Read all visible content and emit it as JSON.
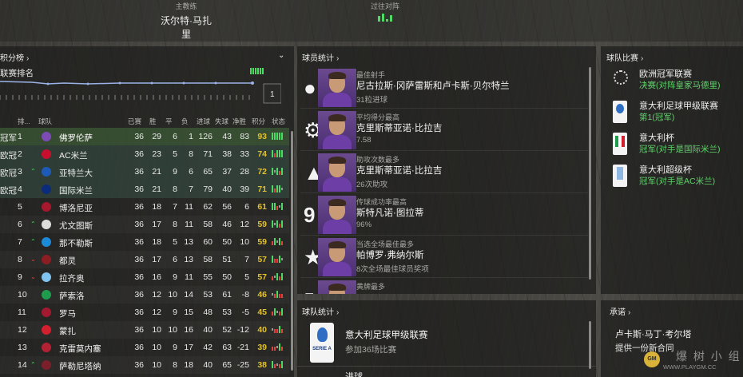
{
  "header": {
    "manager_label": "主教练",
    "manager_name": "沃尔特·马扎里",
    "h2h_label": "过往对阵",
    "h2h_bars": [
      0.7,
      1.0,
      0.35,
      0.8
    ]
  },
  "standings": {
    "title": "积分榜",
    "subtitle": "联赛排名",
    "graph_current": "1",
    "columns": [
      "排...",
      "球队",
      "已赛",
      "胜",
      "平",
      "负",
      "进球",
      "失球",
      "净胜",
      "积分",
      "状态"
    ],
    "rows": [
      {
        "qual": "冠军",
        "pos": "1",
        "move": "",
        "team": "佛罗伦萨",
        "logo": "#7c4bb3",
        "p": "36",
        "w": "29",
        "d": "6",
        "l": "1",
        "gf": "126",
        "ga": "43",
        "gd": "83",
        "pts": "93",
        "form": [
          "W",
          "W",
          "W",
          "W",
          "W"
        ],
        "highlight": true
      },
      {
        "qual": "欧冠",
        "pos": "2",
        "move": "",
        "team": "AC米兰",
        "logo": "#c8102e",
        "p": "36",
        "w": "23",
        "d": "5",
        "l": "8",
        "gf": "71",
        "ga": "38",
        "gd": "33",
        "pts": "74",
        "form": [
          "W",
          "L",
          "W",
          "W",
          "W"
        ]
      },
      {
        "qual": "欧冠",
        "pos": "3",
        "move": "up",
        "team": "亚特兰大",
        "logo": "#1e5bb8",
        "p": "36",
        "w": "21",
        "d": "9",
        "l": "6",
        "gf": "65",
        "ga": "37",
        "gd": "28",
        "pts": "72",
        "form": [
          "W",
          "D",
          "W",
          "L",
          "W"
        ]
      },
      {
        "qual": "欧冠",
        "pos": "4",
        "move": "",
        "team": "国际米兰",
        "logo": "#0a2c7a",
        "p": "36",
        "w": "21",
        "d": "8",
        "l": "7",
        "gf": "79",
        "ga": "40",
        "gd": "39",
        "pts": "71",
        "form": [
          "W",
          "L",
          "W",
          "W",
          "D"
        ]
      },
      {
        "qual": "",
        "pos": "5",
        "move": "",
        "team": "博洛尼亚",
        "logo": "#a5182d",
        "p": "36",
        "w": "18",
        "d": "7",
        "l": "11",
        "gf": "62",
        "ga": "56",
        "gd": "6",
        "pts": "61",
        "form": [
          "W",
          "W",
          "L",
          "D",
          "W"
        ]
      },
      {
        "qual": "",
        "pos": "6",
        "move": "up",
        "team": "尤文图斯",
        "logo": "#dddddd",
        "p": "36",
        "w": "17",
        "d": "8",
        "l": "11",
        "gf": "58",
        "ga": "46",
        "gd": "12",
        "pts": "59",
        "form": [
          "W",
          "D",
          "W",
          "L",
          "W"
        ]
      },
      {
        "qual": "",
        "pos": "7",
        "move": "up",
        "team": "那不勒斯",
        "logo": "#1c8ad6",
        "p": "36",
        "w": "18",
        "d": "5",
        "l": "13",
        "gf": "60",
        "ga": "50",
        "gd": "10",
        "pts": "59",
        "form": [
          "L",
          "W",
          "D",
          "W",
          "L"
        ]
      },
      {
        "qual": "",
        "pos": "8",
        "move": "down",
        "team": "都灵",
        "logo": "#8b1e22",
        "p": "36",
        "w": "17",
        "d": "6",
        "l": "13",
        "gf": "58",
        "ga": "51",
        "gd": "7",
        "pts": "57",
        "form": [
          "W",
          "L",
          "L",
          "W",
          "D"
        ]
      },
      {
        "qual": "",
        "pos": "9",
        "move": "down",
        "team": "拉齐奥",
        "logo": "#7fc3ee",
        "p": "36",
        "w": "16",
        "d": "9",
        "l": "11",
        "gf": "55",
        "ga": "50",
        "gd": "5",
        "pts": "57",
        "form": [
          "L",
          "D",
          "W",
          "L",
          "W"
        ]
      },
      {
        "qual": "",
        "pos": "10",
        "move": "",
        "team": "萨索洛",
        "logo": "#1e9b4c",
        "p": "36",
        "w": "12",
        "d": "10",
        "l": "14",
        "gf": "53",
        "ga": "61",
        "gd": "-8",
        "pts": "46",
        "form": [
          "D",
          "L",
          "W",
          "L",
          "L"
        ]
      },
      {
        "qual": "",
        "pos": "11",
        "move": "",
        "team": "罗马",
        "logo": "#a3192f",
        "p": "36",
        "w": "12",
        "d": "9",
        "l": "15",
        "gf": "48",
        "ga": "53",
        "gd": "-5",
        "pts": "45",
        "form": [
          "L",
          "W",
          "D",
          "L",
          "W"
        ]
      },
      {
        "qual": "",
        "pos": "12",
        "move": "",
        "team": "蒙扎",
        "logo": "#d3202f",
        "p": "36",
        "w": "10",
        "d": "10",
        "l": "16",
        "gf": "40",
        "ga": "52",
        "gd": "-12",
        "pts": "40",
        "form": [
          "D",
          "L",
          "L",
          "W",
          "L"
        ]
      },
      {
        "qual": "",
        "pos": "13",
        "move": "",
        "team": "克雷莫内塞",
        "logo": "#b22234",
        "p": "36",
        "w": "10",
        "d": "9",
        "l": "17",
        "gf": "42",
        "ga": "63",
        "gd": "-21",
        "pts": "39",
        "form": [
          "L",
          "L",
          "D",
          "W",
          "L"
        ]
      },
      {
        "qual": "",
        "pos": "14",
        "move": "up",
        "team": "萨勒尼塔纳",
        "logo": "#7b1f2a",
        "p": "36",
        "w": "10",
        "d": "8",
        "l": "18",
        "gf": "40",
        "ga": "65",
        "gd": "-25",
        "pts": "38",
        "form": [
          "W",
          "L",
          "D",
          "L",
          "W"
        ]
      }
    ]
  },
  "player_stats": {
    "title": "球员统计",
    "items": [
      {
        "icon": "ball-icon",
        "category": "最佳射手",
        "name": "尼古拉斯·冈萨雷斯和卢卡斯·贝尔特兰",
        "stat": "31粒进球"
      },
      {
        "icon": "gear-icon",
        "category": "平均得分最高",
        "name": "克里斯蒂亚诺·比拉吉",
        "stat": "7.58"
      },
      {
        "icon": "assist-icon",
        "category": "助攻次数最多",
        "name": "克里斯蒂亚诺·比拉吉",
        "stat": "26次助攻"
      },
      {
        "icon": "pass-icon",
        "category": "传球成功率最高",
        "name": "斯特凡诺·图拉蒂",
        "stat": "96%"
      },
      {
        "icon": "star-icon",
        "category": "当选全场最佳最多",
        "name": "帕博罗·弗纳尔斯",
        "stat": "8次全场最佳球员奖项"
      },
      {
        "icon": "card-icon",
        "category": "黄牌最多",
        "name": "",
        "stat": ""
      }
    ]
  },
  "team_competitions": {
    "title": "球队比赛",
    "items": [
      {
        "logo": "ucl",
        "name": "欧洲冠军联赛",
        "result": "决赛(对阵皇家马德里)"
      },
      {
        "logo": "seriea",
        "name": "意大利足球甲级联赛",
        "result": "第1(冠军)"
      },
      {
        "logo": "coppa",
        "name": "意大利杯",
        "result": "冠军(对手是国际米兰)"
      },
      {
        "logo": "supercoppa",
        "name": "意大利超级杯",
        "result": "冠军(对手是AC米兰)"
      }
    ]
  },
  "team_stats": {
    "title": "球队统计",
    "items": [
      {
        "name": "意大利足球甲级联赛",
        "detail": "参加36场比赛"
      },
      {
        "name": "进球",
        "detail": ""
      }
    ]
  },
  "promises": {
    "title": "承诺",
    "person": "卢卡斯·马丁·考尔塔",
    "text": "提供一份新合同"
  },
  "watermark": {
    "text": "爆 树 小 组",
    "url": "WWW.PLAYGM.CC"
  },
  "colors": {
    "win": "#4cd964",
    "loss": "#e0443c",
    "draw": "#9a9a96",
    "accent_green": "#5ed36a",
    "points": "#e2c12f"
  }
}
